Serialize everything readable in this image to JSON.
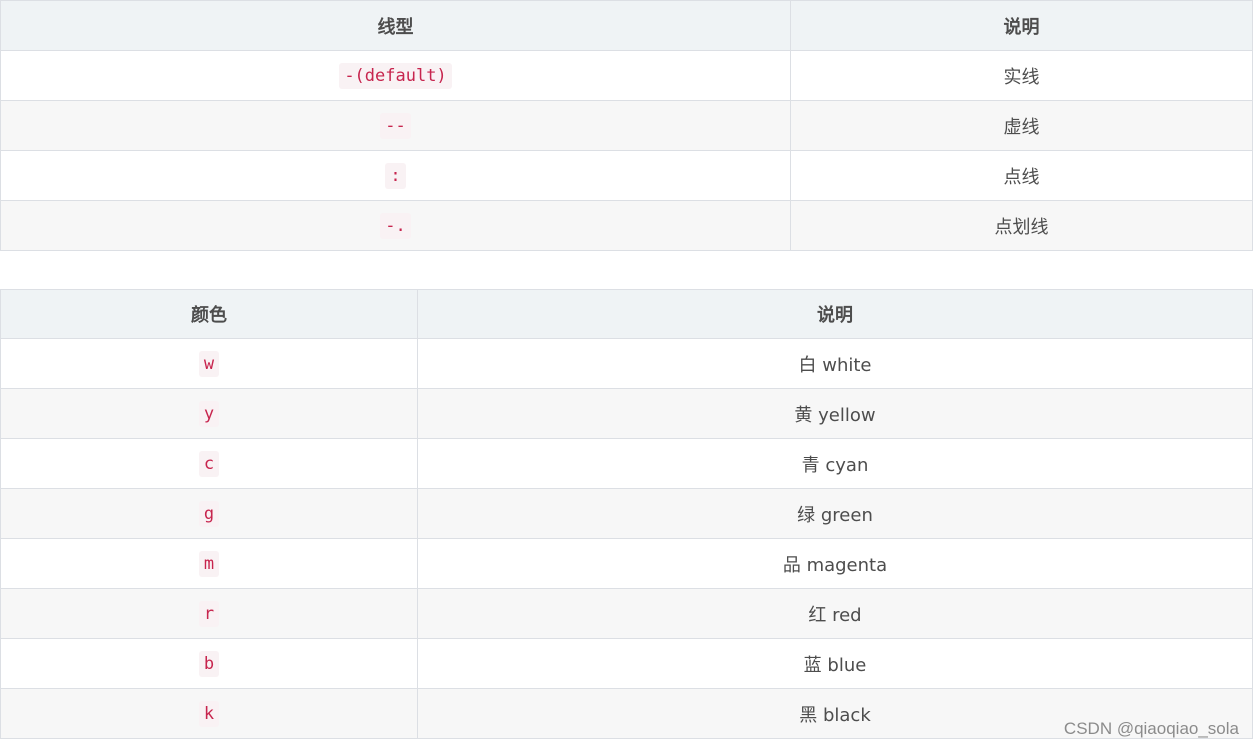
{
  "linestyle_table": {
    "headers": [
      "线型",
      "说明"
    ],
    "rows": [
      {
        "code": "-(default)",
        "desc": "实线"
      },
      {
        "code": "--",
        "desc": "虚线"
      },
      {
        "code": ":",
        "desc": "点线"
      },
      {
        "code": "-.",
        "desc": "点划线"
      }
    ]
  },
  "color_table": {
    "headers": [
      "颜色",
      "说明"
    ],
    "rows": [
      {
        "code": "w",
        "desc": "白 white"
      },
      {
        "code": "y",
        "desc": "黄 yellow"
      },
      {
        "code": "c",
        "desc": "青 cyan"
      },
      {
        "code": "g",
        "desc": "绿 green"
      },
      {
        "code": "m",
        "desc": "品 magenta"
      },
      {
        "code": "r",
        "desc": "红 red"
      },
      {
        "code": "b",
        "desc": "蓝 blue"
      },
      {
        "code": "k",
        "desc": "黑 black"
      }
    ]
  },
  "watermark": "CSDN @qiaoqiao_sola"
}
